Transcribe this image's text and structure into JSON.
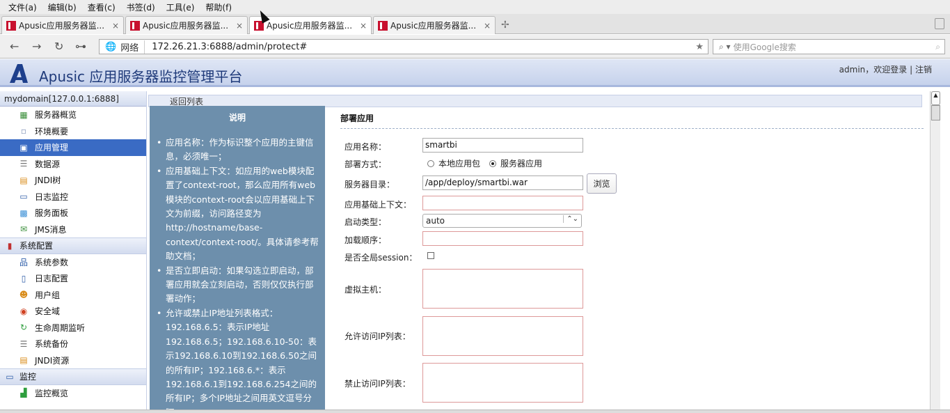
{
  "menu": [
    "文件(a)",
    "编辑(b)",
    "查看(c)",
    "书签(d)",
    "工具(e)",
    "帮助(f)"
  ],
  "tabs": [
    {
      "title": "Apusic应用服务器监...",
      "close": "×",
      "active": false
    },
    {
      "title": "Apusic应用服务器监...",
      "close": "×",
      "active": false
    },
    {
      "title": "Apusic应用服务器监...",
      "close": "×",
      "active": true
    },
    {
      "title": "Apusic应用服务器监...",
      "close": "×",
      "active": false
    }
  ],
  "newtab": "✢",
  "nav": {
    "back": "←",
    "forward": "→",
    "reload": "↻",
    "key": "⊶"
  },
  "address": {
    "globe": "🌐",
    "network": "网络",
    "url": "172.26.21.3:6888/admin/protect#",
    "star": "★"
  },
  "search": {
    "icon": "⌕ ▾",
    "placeholder": "使用Google搜索",
    "icon2": "⌕"
  },
  "app": {
    "title": "Apusic 应用服务器监控管理平台",
    "user": "admin，欢迎登录",
    "sep": "|",
    "logout": "注销"
  },
  "sidebar": {
    "domain": "mydomain[127.0.0.1:6888]",
    "group1": [
      {
        "label": "服务器概览",
        "icon": "server-icon",
        "glyph": "▦",
        "color": "#3b8f3b"
      },
      {
        "label": "环境概要",
        "icon": "grid-icon",
        "glyph": "▫",
        "color": "#8899bb"
      },
      {
        "label": "应用管理",
        "icon": "app-icon",
        "glyph": "▣",
        "color": "#ffffff",
        "active": true
      },
      {
        "label": "数据源",
        "icon": "database-icon",
        "glyph": "☰",
        "color": "#777"
      },
      {
        "label": "JNDI树",
        "icon": "tree-icon",
        "glyph": "▤",
        "color": "#d98c1a"
      },
      {
        "label": "日志监控",
        "icon": "monitor-icon",
        "glyph": "▭",
        "color": "#2f5ea8"
      },
      {
        "label": "服务面板",
        "icon": "panel-icon",
        "glyph": "▩",
        "color": "#3a8fd6"
      },
      {
        "label": "JMS消息",
        "icon": "message-icon",
        "glyph": "✉",
        "color": "#3b8f3b"
      }
    ],
    "sysconfig": {
      "label": "系统配置",
      "icon": "book-icon",
      "glyph": "▮",
      "color": "#c03030"
    },
    "group2": [
      {
        "label": "系统参数",
        "icon": "network-icon",
        "glyph": "品",
        "color": "#2f5ea8"
      },
      {
        "label": "日志配置",
        "icon": "document-icon",
        "glyph": "▯",
        "color": "#2f5ea8"
      },
      {
        "label": "用户组",
        "icon": "users-icon",
        "glyph": "☻",
        "color": "#d98c1a"
      },
      {
        "label": "安全域",
        "icon": "lifebuoy-icon",
        "glyph": "◉",
        "color": "#d04020"
      },
      {
        "label": "生命周期监听",
        "icon": "cycle-icon",
        "glyph": "↻",
        "color": "#2e9e3e"
      },
      {
        "label": "系统备份",
        "icon": "backup-icon",
        "glyph": "☰",
        "color": "#777"
      },
      {
        "label": "JNDI资源",
        "icon": "jndi-resource-icon",
        "glyph": "▤",
        "color": "#d98c1a"
      }
    ],
    "monitor": {
      "label": "监控",
      "icon": "monitor-group-icon",
      "glyph": "▭",
      "color": "#2f5ea8"
    },
    "group3": [
      {
        "label": "监控概览",
        "icon": "chart-icon",
        "glyph": "▟",
        "color": "#2e9e3e"
      }
    ]
  },
  "main": {
    "back": "返回列表",
    "help_title": "说明",
    "help_items": [
      "应用名称：作为标识整个应用的主键信息，必须唯一；",
      "应用基础上下文：如应用的web模块配置了context-root，那么应用所有web模块的context-root会以应用基础上下文为前缀，访问路径变为http://hostname/base-context/context-root/。具体请参考帮助文档；",
      "是否立即启动：如果勾选立即启动，部署应用就会立刻启动，否则仅仅执行部署动作；",
      "允许或禁止IP地址列表格式：192.168.6.5：表示IP地址192.168.6.5；192.168.6.10-50：表示192.168.6.10到192.168.6.50之间的所有IP；192.168.6.*：表示192.168.6.1到192.168.6.254之间的所有IP；多个IP地址之间用英文逗号分隔。"
    ],
    "form": {
      "title": "部署应用",
      "app_name_label": "应用名称：",
      "app_name": "smartbi",
      "deploy_label": "部署方式：",
      "deploy_opt1": "本地应用包",
      "deploy_opt2": "服务器应用",
      "dir_label": "服务器目录：",
      "dir": "/app/deploy/smartbi.war",
      "browse": "浏览",
      "context_label": "应用基础上下文：",
      "context": "",
      "start_label": "启动类型：",
      "start": "auto",
      "order_label": "加载顺序：",
      "order": "",
      "session_label": "是否全局session：",
      "vhost_label": "虚拟主机：",
      "allow_label": "允许访问IP列表：",
      "deny_label": "禁止访问IP列表："
    }
  }
}
